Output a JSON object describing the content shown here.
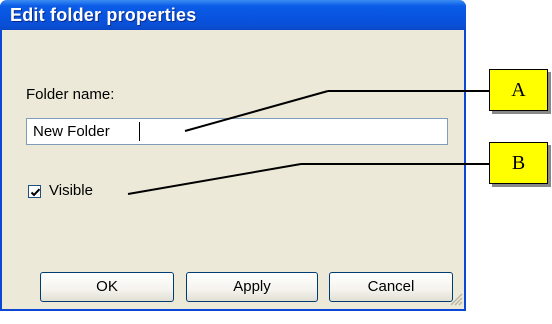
{
  "dialog": {
    "title": "Edit folder properties",
    "folder_label": "Folder name:",
    "folder_value": "New Folder",
    "visible_label": "Visible",
    "visible_checked": true,
    "buttons": {
      "ok": "OK",
      "apply": "Apply",
      "cancel": "Cancel"
    }
  },
  "annotations": {
    "a": "A",
    "b": "B"
  },
  "colors": {
    "titlebar": "#0a5ce8",
    "dialog_bg": "#ece9d8",
    "annotation_bg": "#ffff00"
  },
  "icons": {
    "checkmark": "check-mark-icon",
    "resize": "resize-grip-icon"
  }
}
